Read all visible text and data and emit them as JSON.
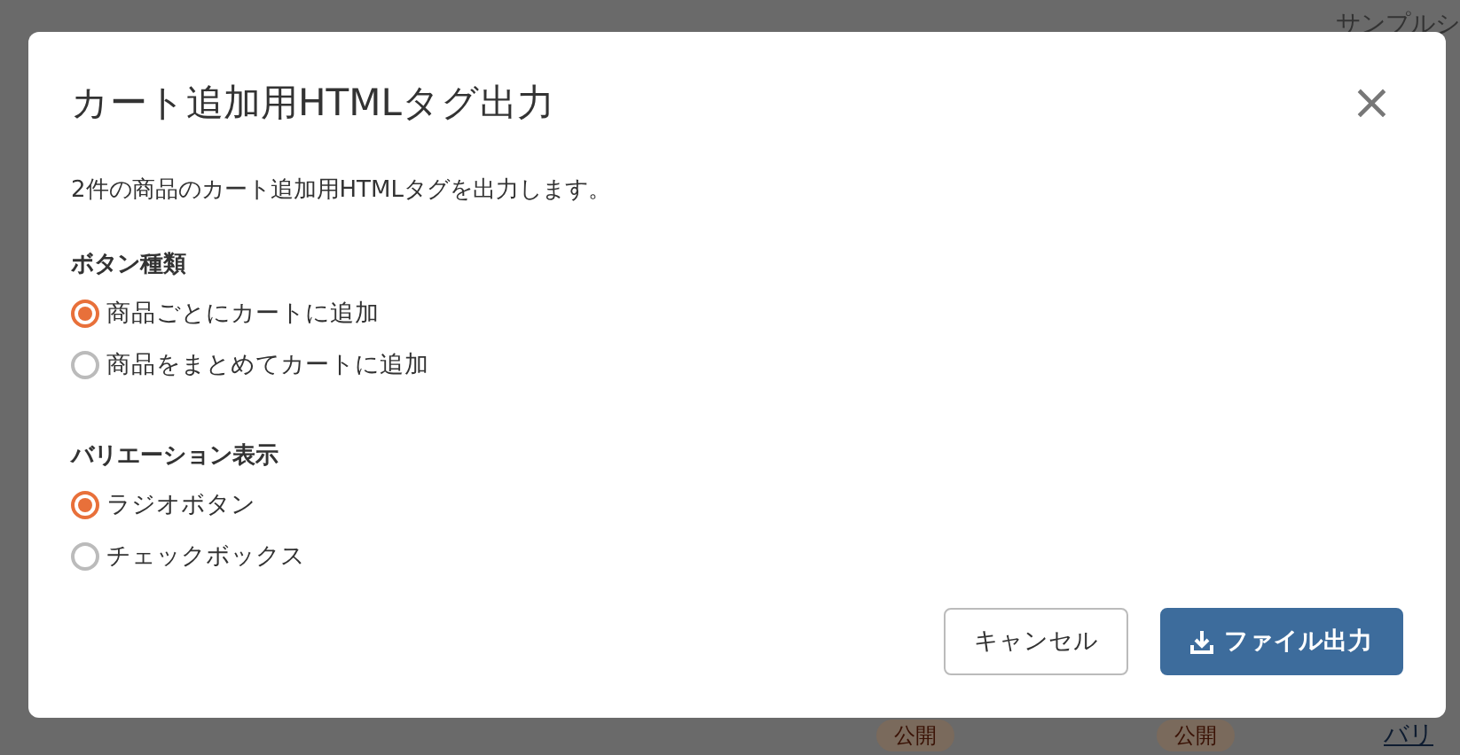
{
  "background": {
    "header_text": "サンプルシ",
    "row": [
      {
        "kind": "badge",
        "text": "公開"
      },
      {
        "kind": "badge",
        "text": "公開"
      },
      {
        "kind": "link",
        "text": "バリ"
      }
    ]
  },
  "dialog": {
    "title": "カート追加用HTMLタグ出力",
    "close": "×",
    "description": "2件の商品のカート追加用HTMLタグを出力します。",
    "groups": [
      {
        "heading": "ボタン種類",
        "options": [
          {
            "label": "商品ごとにカートに追加",
            "selected": true
          },
          {
            "label": "商品をまとめてカートに追加",
            "selected": false
          }
        ]
      },
      {
        "heading": "バリエーション表示",
        "options": [
          {
            "label": "ラジオボタン",
            "selected": true
          },
          {
            "label": "チェックボックス",
            "selected": false
          }
        ]
      }
    ],
    "buttons": [
      {
        "kind": "secondary",
        "label": "キャンセル"
      },
      {
        "kind": "primary",
        "label": "ファイル出力"
      }
    ]
  }
}
